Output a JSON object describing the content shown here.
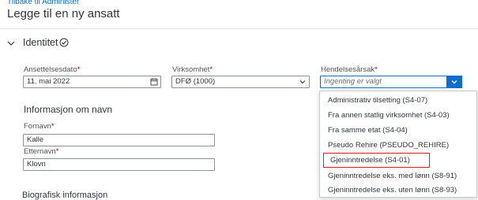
{
  "header": {
    "back_link": "Tilbake til Administer",
    "title": "Legge til en ny ansatt"
  },
  "section": {
    "title": "Identitet",
    "status_icon": "check-circle-icon",
    "toggle_icon": "chevron-down-icon"
  },
  "fields": {
    "start_date": {
      "label": "Ansettelsesdato",
      "value": "11. mai 2022",
      "icon": "calendar-icon"
    },
    "company": {
      "label": "Virksomhet",
      "value": "DFØ (1000)",
      "icon": "chevron-down-icon"
    },
    "event_reason": {
      "label": "Hendelsesårsak",
      "placeholder": "Ingenting er valgt",
      "icon": "chevron-down-icon"
    }
  },
  "required_marker": "*",
  "name_section": {
    "title": "Informasjon om navn",
    "first_name": {
      "label": "Fornavn",
      "value": "Kalle"
    },
    "last_name": {
      "label": "Etternavn",
      "value": "Klovn"
    }
  },
  "dropdown": {
    "options": [
      "Administrativ tilsetting (S4-07)",
      "Fra annen statlig virksomhet (S4-03)",
      "Fra samme etat (S4-04)",
      "Pseudo Rehire (PSEUDO_REHIRE)",
      "Gjeninntredelse (S4-01)",
      "Gjeninntredelse eks. med lønn (S8-91)",
      "Gjeninntredelse eks. uten lønn (S8-93)"
    ],
    "highlighted_index": 4,
    "highlight_color": "#e01a1a"
  },
  "next_section": {
    "title": "Biografisk informasjon"
  },
  "colors": {
    "accent": "#0a6ed1",
    "required": "#bb0000"
  }
}
